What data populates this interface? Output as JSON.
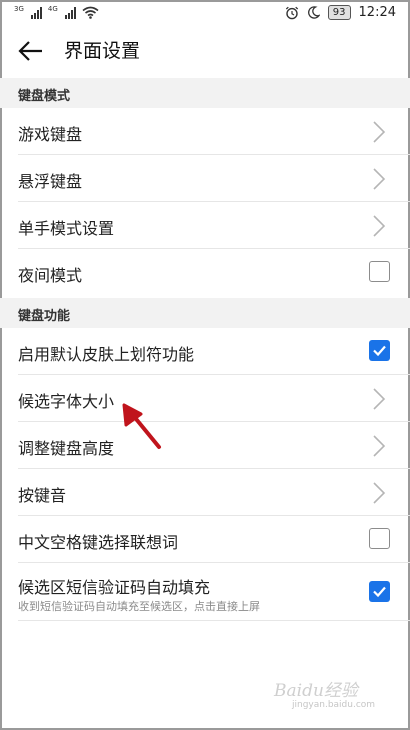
{
  "status_bar": {
    "network_1": "3G",
    "network_2": "4G",
    "battery": "93",
    "time": "12:24"
  },
  "header": {
    "title": "界面设置"
  },
  "sections": [
    {
      "title": "键盘模式",
      "items": [
        {
          "label": "游戏键盘",
          "control": "chevron"
        },
        {
          "label": "悬浮键盘",
          "control": "chevron"
        },
        {
          "label": "单手模式设置",
          "control": "chevron"
        },
        {
          "label": "夜间模式",
          "control": "checkbox",
          "checked": false
        }
      ]
    },
    {
      "title": "键盘功能",
      "items": [
        {
          "label": "启用默认皮肤上划符功能",
          "control": "checkbox",
          "checked": true
        },
        {
          "label": "候选字体大小",
          "control": "chevron"
        },
        {
          "label": "调整键盘高度",
          "control": "chevron"
        },
        {
          "label": "按键音",
          "control": "chevron"
        },
        {
          "label": "中文空格键选择联想词",
          "control": "checkbox",
          "checked": false
        },
        {
          "label": "候选区短信验证码自动填充",
          "sublabel": "收到短信验证码自动填充至候选区，点击直接上屏",
          "control": "checkbox",
          "checked": true
        }
      ]
    }
  ],
  "colors": {
    "accent": "#1a73e8",
    "annotation_arrow": "#c0141c"
  },
  "watermark": {
    "brand": "Baidu经验",
    "url": "jingyan.baidu.com"
  }
}
